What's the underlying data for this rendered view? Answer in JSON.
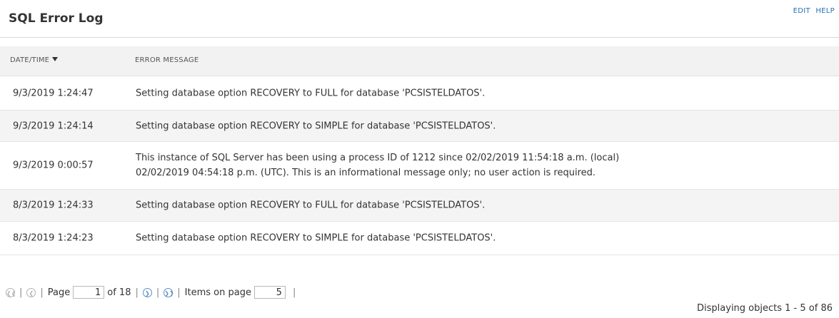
{
  "header": {
    "title": "SQL Error Log",
    "edit_label": "EDIT",
    "help_label": "HELP"
  },
  "table": {
    "columns": [
      "DATE/TIME",
      "ERROR MESSAGE"
    ],
    "rows": [
      {
        "date": "9/3/2019 1:24:47",
        "message": "Setting database option RECOVERY to FULL for database 'PCSISTELDATOS'."
      },
      {
        "date": "9/3/2019 1:24:14",
        "message": "Setting database option RECOVERY to SIMPLE for database 'PCSISTELDATOS'."
      },
      {
        "date": "9/3/2019 0:00:57",
        "message": "This instance of SQL Server has been using a process ID of 1212 since 02/02/2019 11:54:18 a.m. (local)\n02/02/2019 04:54:18 p.m. (UTC). This is an informational message only; no user action is required."
      },
      {
        "date": "8/3/2019 1:24:33",
        "message": "Setting database option RECOVERY to FULL for database 'PCSISTELDATOS'."
      },
      {
        "date": "8/3/2019 1:24:23",
        "message": "Setting database option RECOVERY to SIMPLE for database 'PCSISTELDATOS'."
      }
    ]
  },
  "pager": {
    "page_label": "Page",
    "page_value": "1",
    "of_label": "of 18",
    "items_label": "Items on page",
    "items_value": "5",
    "separator": "|"
  },
  "status": {
    "display_count": "Displaying objects 1 - 5 of 86"
  },
  "colors": {
    "link": "#2a6fb0",
    "header_bg": "#f2f2f2",
    "row_alt_bg": "#f4f4f4"
  },
  "icons": {
    "first": "first-page-icon",
    "prev": "previous-page-icon",
    "next": "next-page-icon",
    "last": "last-page-icon",
    "sort": "sort-descending-icon"
  }
}
